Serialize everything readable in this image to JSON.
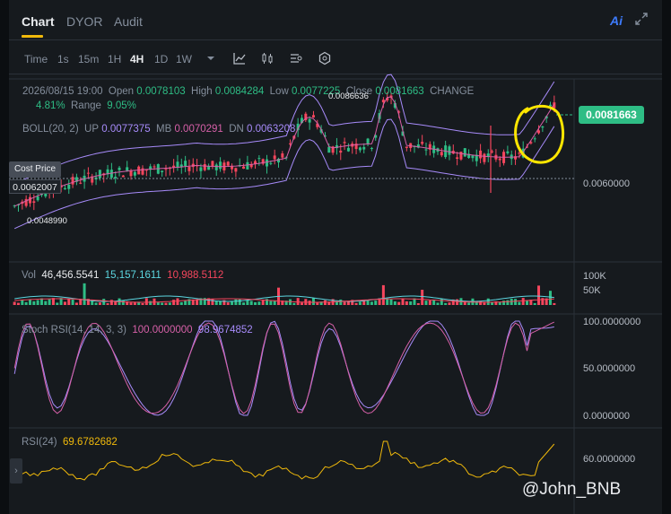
{
  "tabs": [
    {
      "label": "Chart"
    },
    {
      "label": "DYOR"
    },
    {
      "label": "Audit"
    }
  ],
  "header": {
    "ai_label": "Ai"
  },
  "timeframes": [
    {
      "label": "Time"
    },
    {
      "label": "1s"
    },
    {
      "label": "15m"
    },
    {
      "label": "1H"
    },
    {
      "label": "4H"
    },
    {
      "label": "1D"
    },
    {
      "label": "1W"
    }
  ],
  "active_timeframe": "4H",
  "ohlc": {
    "date": "2026/08/15 19:00",
    "open_label": "Open",
    "open": "0.0078103",
    "high_label": "High",
    "high": "0.0084284",
    "low_label": "Low",
    "low": "0.0077225",
    "close_label": "Close",
    "close": "0.0081663",
    "change_label": "CHANGE",
    "change": "4.81%",
    "range_label": "Range",
    "range": "9.05%"
  },
  "boll": {
    "label": "BOLL(20, 2)",
    "up_label": "UP",
    "up": "0.0077375",
    "mb_label": "MB",
    "mb": "0.0070291",
    "dn_label": "DN",
    "dn": "0.0063208"
  },
  "vol": {
    "label": "Vol",
    "v1": "46,456.5541",
    "v2": "15,157.1611",
    "v3": "10,988.5112"
  },
  "stoch": {
    "label": "Stoch RSI(14, 14, 3, 3)",
    "k": "100.0000000",
    "d": "98.9674852"
  },
  "rsi": {
    "label": "RSI(24)",
    "value": "69.6782682"
  },
  "price_axis": {
    "tag": "0.0081663",
    "level": "0.0060000",
    "max_mark": "0.0086636",
    "min_mark": "0.0048990"
  },
  "cost": {
    "title": "Cost Price",
    "value": "0.0062007"
  },
  "vol_axis": {
    "t1": "100K",
    "t2": "50K"
  },
  "stoch_axis": {
    "t1": "100.0000000",
    "t2": "50.0000000",
    "t3": "0.0000000"
  },
  "rsi_axis": {
    "t1": "60.0000000"
  },
  "watermark": "@John_BNB",
  "colors": {
    "up": "#2ebd85",
    "down": "#f6465d",
    "boll_band": "#a78bfa",
    "mb": "#d660a8",
    "stoch_k": "#d660a8",
    "stoch_d": "#a78bfa",
    "rsi": "#f0b90b",
    "highlight": "#ffe600"
  },
  "chart_data": [
    {
      "type": "candlestick",
      "title": "",
      "x_range": [
        "07/05",
        "08/15"
      ],
      "ylim": [
        0.004,
        0.009
      ],
      "last_close": 0.0081663,
      "high_mark": 0.0086636,
      "low_mark": 0.004899,
      "cost_price": 0.0062007
    },
    {
      "type": "bar",
      "title": "Vol",
      "ylim": [
        0,
        100000
      ]
    },
    {
      "type": "line",
      "title": "Stoch RSI(14, 14, 3, 3)",
      "ylim": [
        0,
        100
      ]
    },
    {
      "type": "line",
      "title": "RSI(24)",
      "last_value": 69.6782682
    }
  ]
}
